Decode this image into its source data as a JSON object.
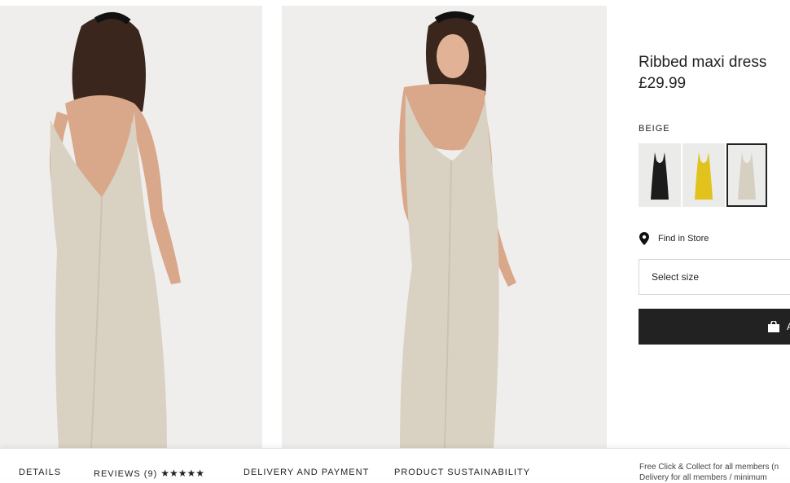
{
  "product": {
    "title": "Ribbed maxi dress",
    "price": "£29.99",
    "color_name": "BEIGE"
  },
  "swatches": [
    {
      "label": "black",
      "color": "#1c1c1c"
    },
    {
      "label": "yellow",
      "color": "#e2c21d"
    },
    {
      "label": "beige",
      "color": "#d6d0c2",
      "selected": true
    }
  ],
  "find_in_store": "Find in Store",
  "size_select": {
    "placeholder": "Select size"
  },
  "add_button": {
    "label": "A"
  },
  "tabs": {
    "details": "DETAILS",
    "reviews": "REVIEWS (9)",
    "reviews_stars": "★★★★★",
    "delivery": "DELIVERY AND PAYMENT",
    "sustainability": "PRODUCT SUSTAINABILITY"
  },
  "promo": {
    "line1": "Free Click & Collect for all members (n",
    "line2": "Delivery for all members / minimum"
  },
  "colors": {
    "dress": "#d9d2c3",
    "skin": "#d9a78a",
    "hair": "#3a261c",
    "background": "#efeeec",
    "dark": "#222222"
  }
}
